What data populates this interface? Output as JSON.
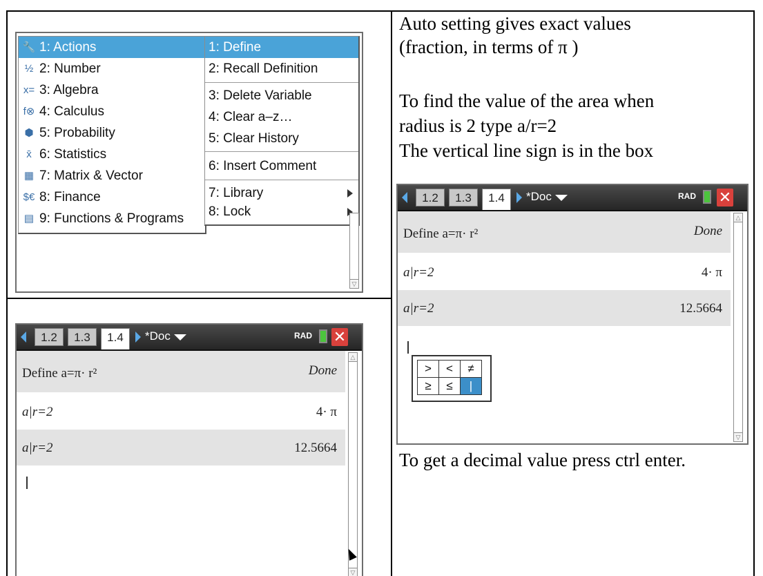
{
  "right_text": {
    "para1_line1": "Auto setting gives exact values",
    "para1_line2": "(fraction, in terms of π )",
    "para2_line1": "To find the value of the area when",
    "para2_line2": "radius is 2 type a/r=2",
    "para2_line3": "The vertical line sign is in the box",
    "bottom": "To get a decimal value press ctrl enter."
  },
  "menu": {
    "main_items": [
      {
        "num": "1: Actions",
        "icon": "actions-icon"
      },
      {
        "num": "2: Number",
        "icon": "number-icon"
      },
      {
        "num": "3: Algebra",
        "icon": "algebra-icon"
      },
      {
        "num": "4: Calculus",
        "icon": "calculus-icon"
      },
      {
        "num": "5: Probability",
        "icon": "probability-icon"
      },
      {
        "num": "6: Statistics",
        "icon": "statistics-icon"
      },
      {
        "num": "7: Matrix & Vector",
        "icon": "matrix-icon"
      },
      {
        "num": "8: Finance",
        "icon": "finance-icon"
      },
      {
        "num": "9: Functions & Programs",
        "icon": "functions-icon"
      }
    ],
    "sub_items": [
      "1: Define",
      "2: Recall Definition",
      "3: Delete Variable",
      "4: Clear a–z…",
      "5: Clear History",
      "6: Insert Comment",
      "7: Library",
      "8: Lock"
    ]
  },
  "calculator": {
    "tabs": [
      "1.2",
      "1.3",
      "1.4"
    ],
    "active_tab": "1.4",
    "doc_name": "*Doc",
    "mode": "RAD",
    "rows": [
      {
        "input": "Define a=π· r²",
        "output": "Done"
      },
      {
        "input": "a|r=2",
        "output": "4· π"
      },
      {
        "input": "a|r=2",
        "output": "12.5664"
      }
    ]
  },
  "relations": {
    "row1": [
      ">",
      "<",
      "≠"
    ],
    "row2": [
      "≥",
      "≤",
      "|"
    ]
  },
  "colors": {
    "accent": "#4aa3d8",
    "close": "#d9413c",
    "battery": "#4cc43d"
  }
}
